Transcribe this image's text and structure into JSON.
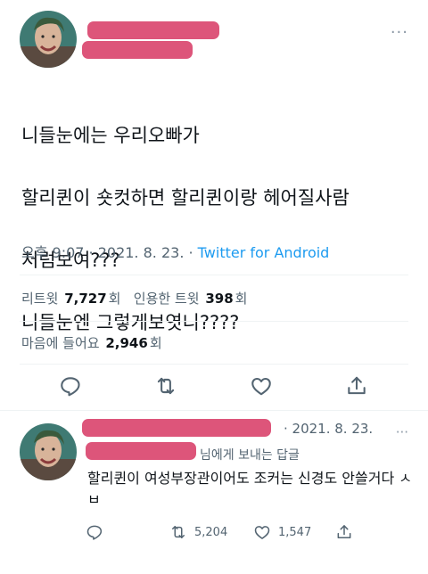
{
  "main_tweet": {
    "text_lines": [
      "니들눈에는 우리오빠가",
      "할리퀸이 숏컷하면 할리퀸이랑 헤어질사람",
      "처럼보여???",
      "니들눈엔 그렇게보엿니????"
    ],
    "timestamp": "오후 9:07 · 2021. 8. 23. · ",
    "source": "Twitter for Android",
    "stats": {
      "retweets_label": "리트윗",
      "retweets": "7,727",
      "retweets_unit": "회",
      "quotes_label": "인용한 트윗",
      "quotes": "398",
      "quotes_unit": "회",
      "likes_label": "마음에 들어요",
      "likes": "2,946",
      "likes_unit": "회"
    },
    "more_icon": "···"
  },
  "reply_tweet": {
    "date": "· 2021. 8. 23.",
    "more_icon": "···",
    "replying_to": "님에게 보내는 답글",
    "text": "할리퀸이 여성부장관이어도 조커는 신경도 안쓸거다 ㅅㅂ",
    "retweets": "5,204",
    "likes": "1,547"
  },
  "colors": {
    "link": "#1d9bf0",
    "muted": "#536471",
    "redaction": "#d9436b"
  },
  "icons": [
    "reply-icon",
    "retweet-icon",
    "like-icon",
    "share-icon",
    "more-icon"
  ]
}
